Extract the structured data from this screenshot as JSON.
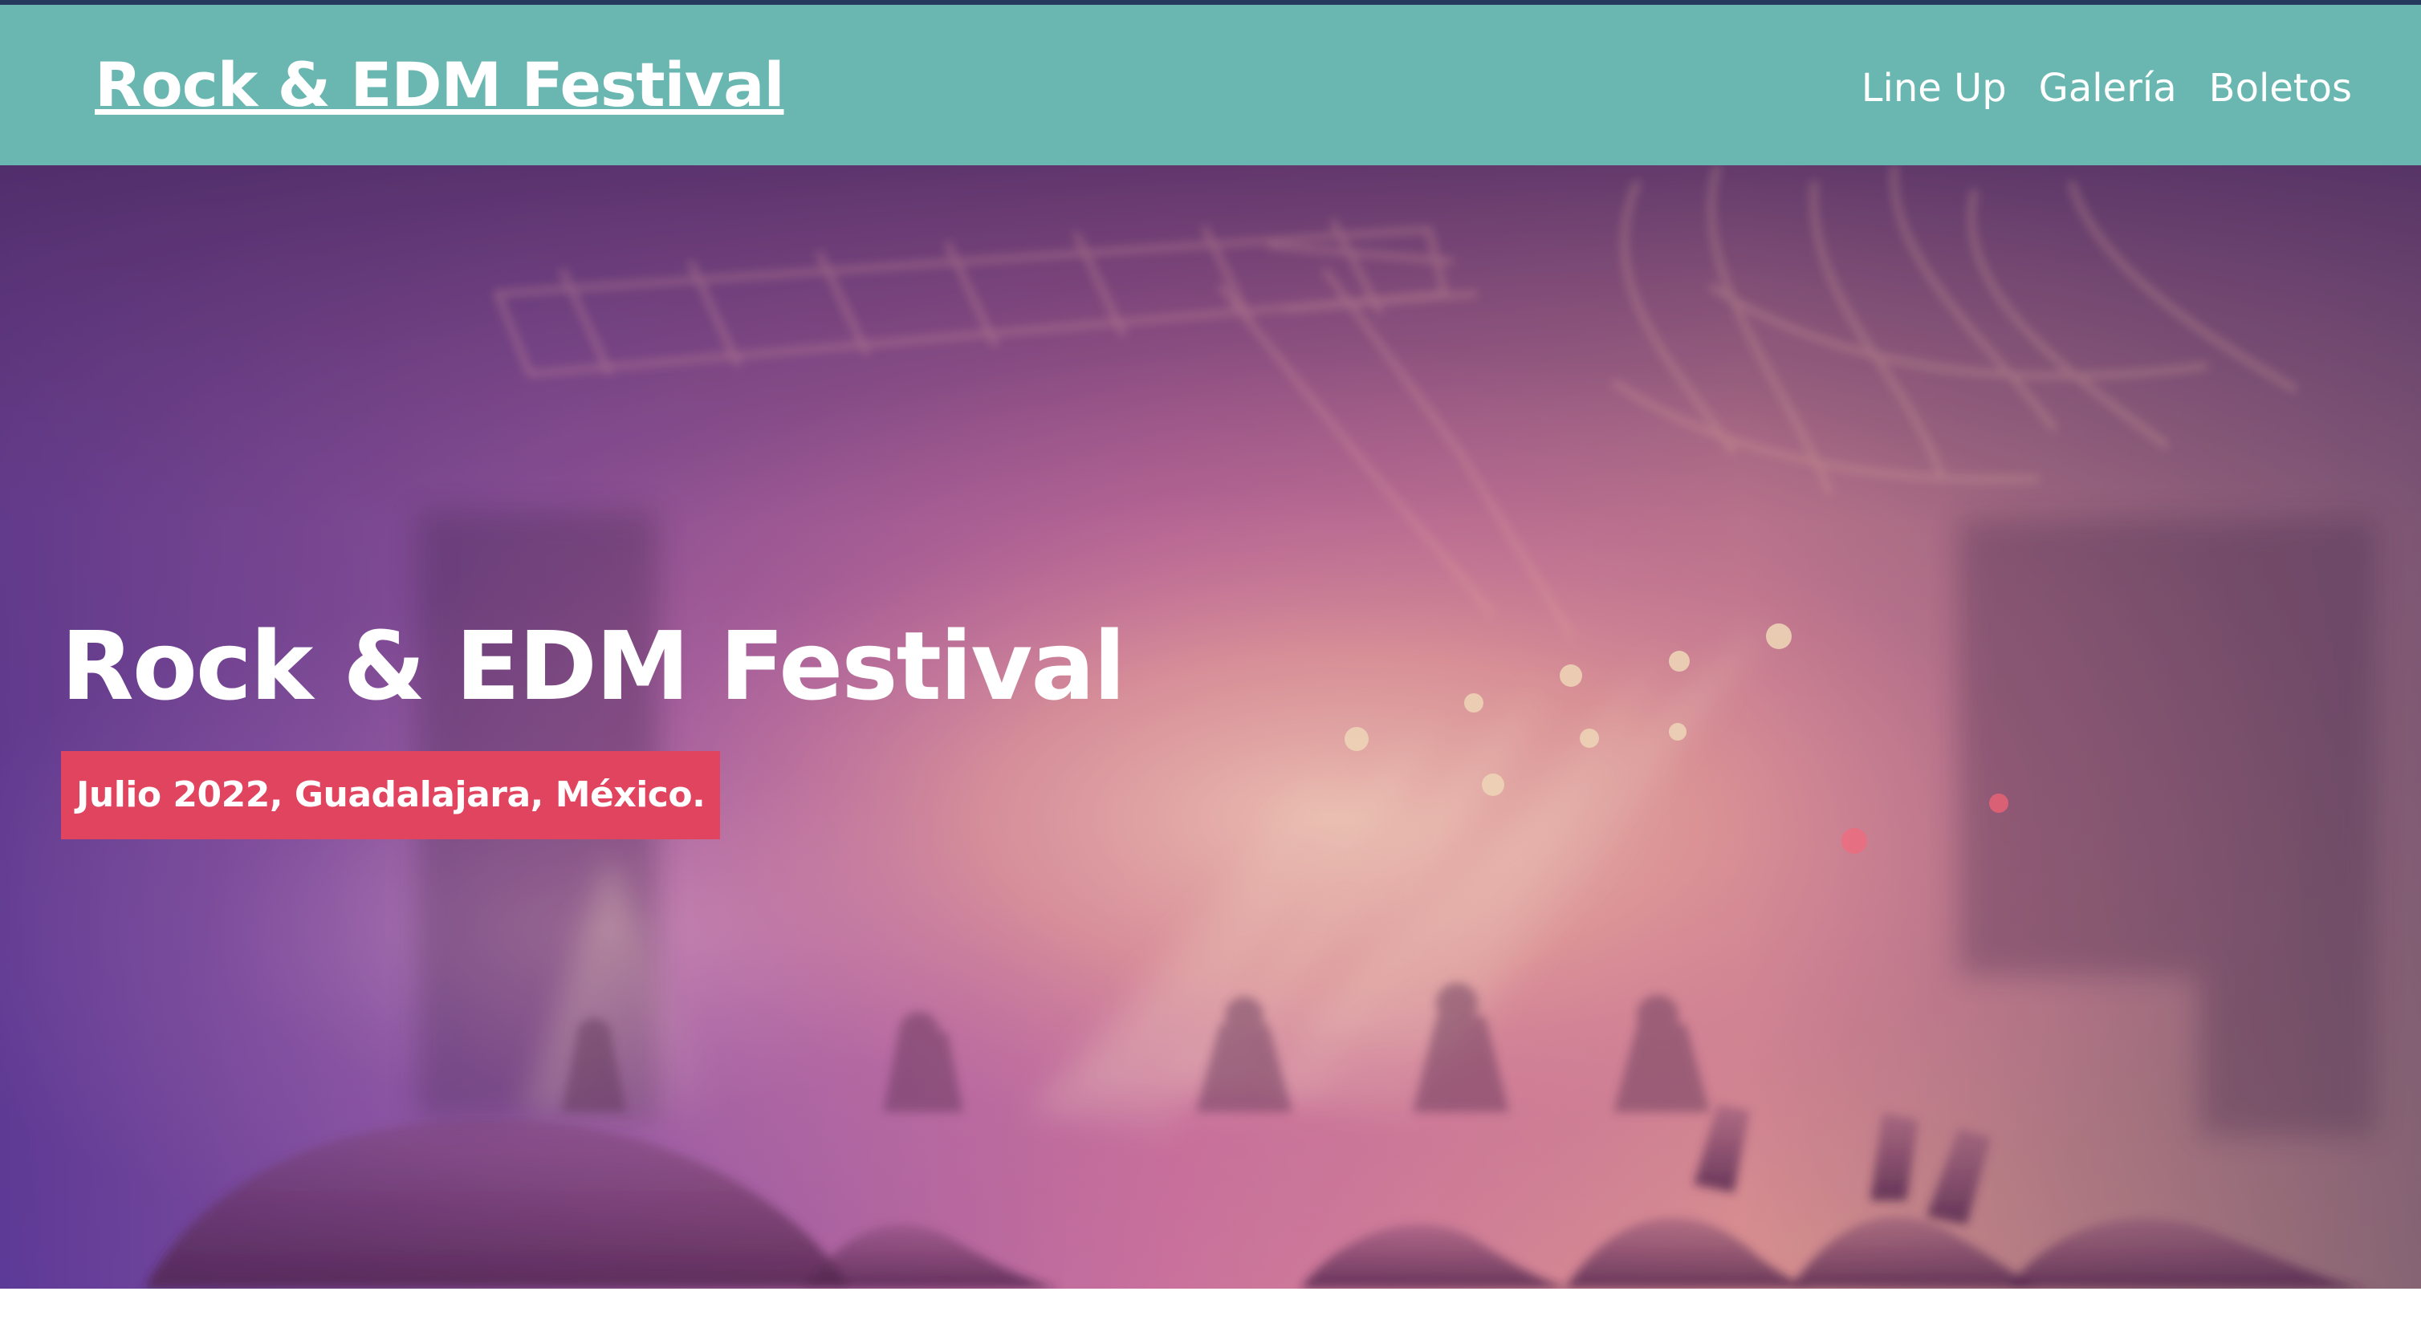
{
  "header": {
    "brand": "Rock & EDM Festival",
    "nav": [
      {
        "label": "Line Up"
      },
      {
        "label": "Galería"
      },
      {
        "label": "Boletos"
      }
    ]
  },
  "hero": {
    "title": "Rock & EDM Festival",
    "date_location": "Julio 2022, Guadalajara, México.",
    "background_image": "concert-stage-crowd-image"
  },
  "colors": {
    "top_edge": "#27385e",
    "header": "#6ab7b1",
    "hero_purple": "#5b3899",
    "hero_pink": "#d777a0",
    "hero_peach": "#f5ad99",
    "date_badge": "#e1445f"
  }
}
